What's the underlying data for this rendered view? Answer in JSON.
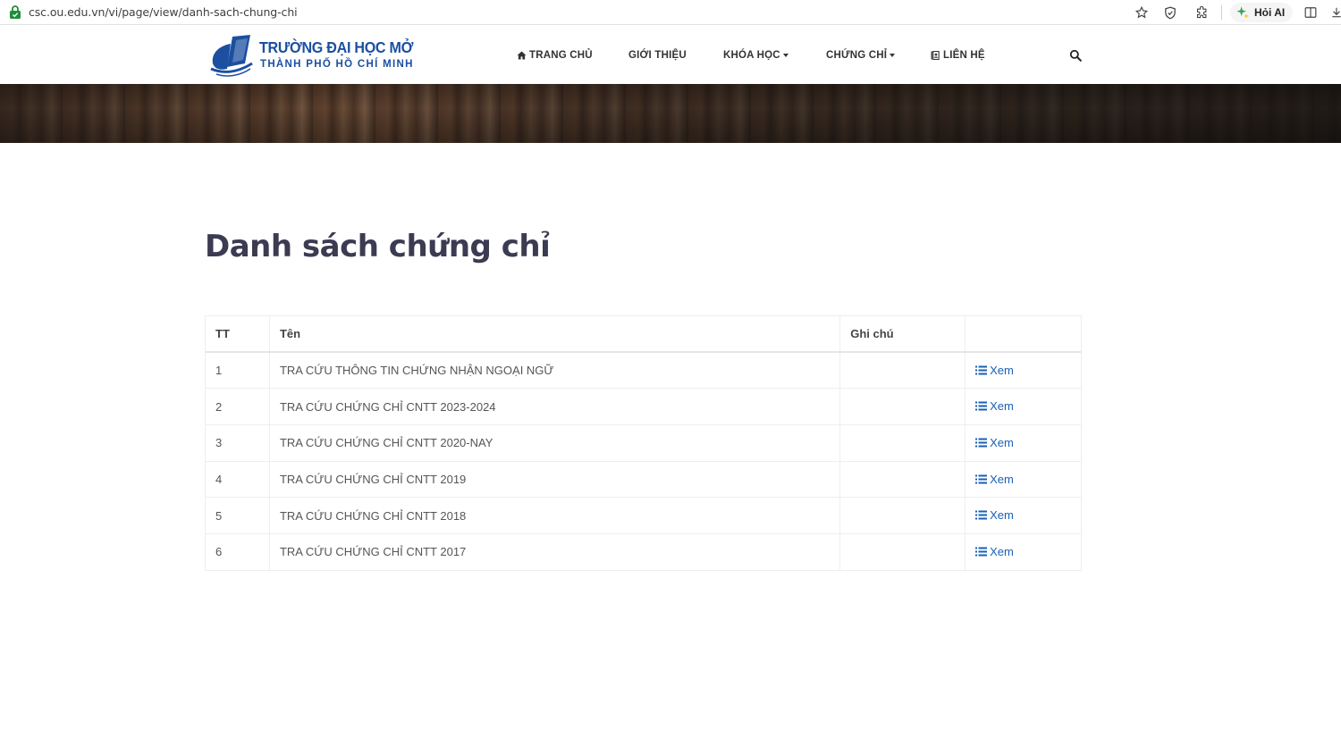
{
  "browser": {
    "url": "csc.ou.edu.vn/vi/page/view/danh-sach-chung-chi",
    "ask_ai_label": "Hỏi AI"
  },
  "header": {
    "logo_line1": "TRƯỜNG ĐẠI HỌC MỞ",
    "logo_line2": "THÀNH PHỐ HỒ CHÍ MINH",
    "nav": {
      "home": "TRANG CHỦ",
      "about": "GIỚI THIỆU",
      "courses": "KHÓA HỌC",
      "certificates": "CHỨNG CHỈ",
      "contact": "LIÊN HỆ"
    }
  },
  "main": {
    "title": "Danh sách chứng chỉ",
    "table": {
      "headers": {
        "no": "TT",
        "name": "Tên",
        "note": "Ghi chú",
        "action": ""
      },
      "view_label": "Xem",
      "rows": [
        {
          "no": "1",
          "name": "TRA CỨU THÔNG TIN CHỨNG NHẬN NGOẠI NGỮ",
          "note": ""
        },
        {
          "no": "2",
          "name": "TRA CỨU CHỨNG CHỈ CNTT 2023-2024",
          "note": ""
        },
        {
          "no": "3",
          "name": "TRA CỨU CHỨNG CHỈ CNTT 2020-NAY",
          "note": ""
        },
        {
          "no": "4",
          "name": "TRA CỨU CHỨNG CHỈ CNTT 2019",
          "note": ""
        },
        {
          "no": "5",
          "name": "TRA CỨU CHỨNG CHỈ CNTT 2018",
          "note": ""
        },
        {
          "no": "6",
          "name": "TRA CỨU CHỨNG CHỈ CNTT 2017",
          "note": ""
        }
      ]
    }
  },
  "colors": {
    "brand": "#1c4fa0",
    "link": "#1a5fb4",
    "title": "#3b3b52"
  }
}
